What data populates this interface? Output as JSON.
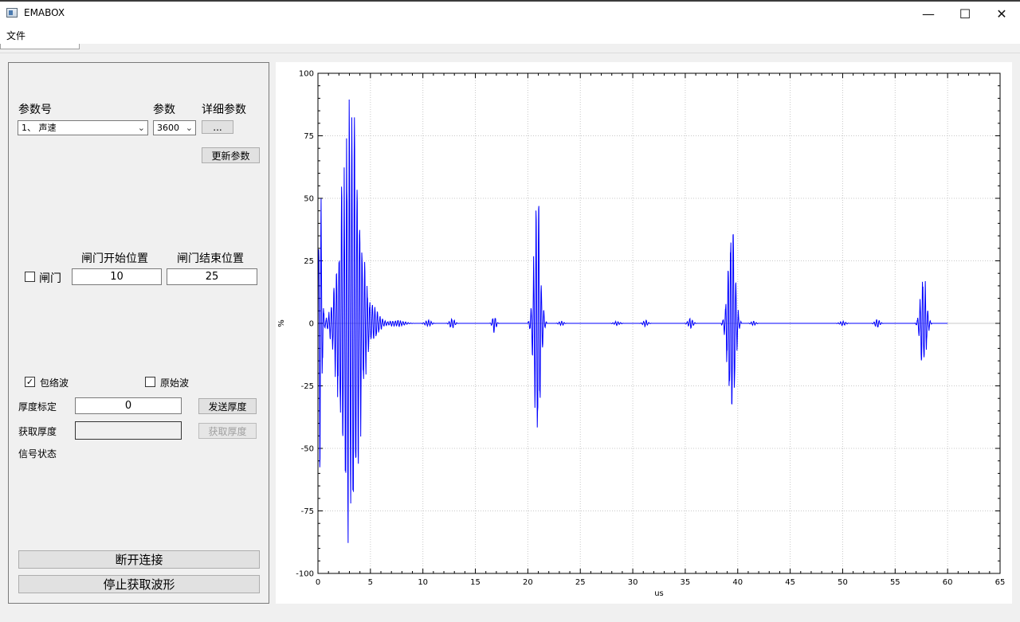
{
  "window": {
    "title": "EMABOX",
    "minimize": "—",
    "maximize": "☐",
    "close": "✕"
  },
  "menu": {
    "file": "文件"
  },
  "params": {
    "param_no_label": "参数号",
    "param_label": "参数",
    "detail_label": "详细参数",
    "param_no_value": "1、 声速",
    "param_value": "3600",
    "detail_button": "...",
    "update_button": "更新参数"
  },
  "gate": {
    "start_label": "闸门开始位置",
    "end_label": "闸门结束位置",
    "checkbox_label": "闸门",
    "checked": false,
    "start_value": "10",
    "end_value": "25"
  },
  "wave": {
    "envelope_label": "包络波",
    "envelope_checked": true,
    "raw_label": "原始波",
    "raw_checked": false
  },
  "thickness": {
    "calib_label": "厚度标定",
    "calib_value": "0",
    "send_button": "发送厚度",
    "get_label": "获取厚度",
    "get_value": "",
    "get_button": "获取厚度",
    "signal_label": "信号状态"
  },
  "actions": {
    "disconnect": "断开连接",
    "stop_wave": "停止获取波形"
  },
  "chart_data": {
    "type": "line",
    "xlabel": "us",
    "ylabel": "%",
    "xlim": [
      0,
      65
    ],
    "ylim": [
      -100,
      100
    ],
    "xticks": [
      "0",
      "5",
      "10",
      "15",
      "20",
      "25",
      "30",
      "35",
      "40",
      "45",
      "50",
      "55",
      "60",
      "65"
    ],
    "yticks": [
      "100",
      "75",
      "50",
      "25",
      "0",
      "-25",
      "-50",
      "-75",
      "-100"
    ],
    "grid": true,
    "color": "#0000ff",
    "data_end_x": 60,
    "bursts": [
      {
        "center": 0.2,
        "width": 0.3,
        "amp": 67
      },
      {
        "center": 3.1,
        "width": 1.6,
        "amp": 97
      },
      {
        "center": 5.5,
        "width": 0.9,
        "amp": 5
      },
      {
        "center": 7.5,
        "width": 1.2,
        "amp": 1.5
      },
      {
        "center": 10.5,
        "width": 0.5,
        "amp": 1.5
      },
      {
        "center": 12.8,
        "width": 0.4,
        "amp": 2.5
      },
      {
        "center": 16.8,
        "width": 0.3,
        "amp": 4
      },
      {
        "center": 20.9,
        "width": 0.55,
        "amp": 60
      },
      {
        "center": 23.2,
        "width": 0.4,
        "amp": 1
      },
      {
        "center": 28.5,
        "width": 0.5,
        "amp": 1
      },
      {
        "center": 31.2,
        "width": 0.4,
        "amp": 1.5
      },
      {
        "center": 35.5,
        "width": 0.4,
        "amp": 2.5
      },
      {
        "center": 39.4,
        "width": 0.6,
        "amp": 49
      },
      {
        "center": 41.5,
        "width": 0.4,
        "amp": 1
      },
      {
        "center": 50.0,
        "width": 0.5,
        "amp": 1
      },
      {
        "center": 53.3,
        "width": 0.4,
        "amp": 2
      },
      {
        "center": 57.7,
        "width": 0.5,
        "amp": 23
      }
    ]
  }
}
